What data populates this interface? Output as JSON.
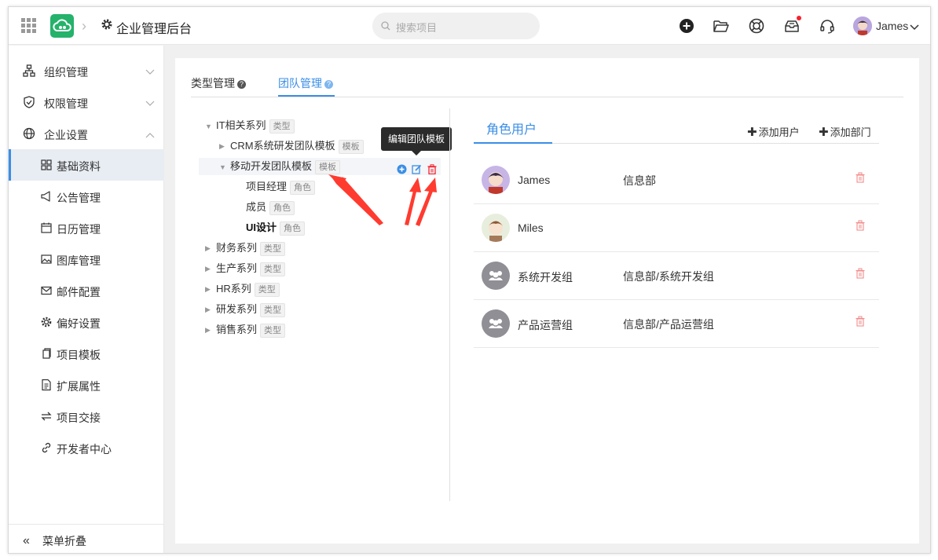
{
  "app": {
    "title": "企业管理后台",
    "search_placeholder": "搜索项目",
    "user_name": "James"
  },
  "sidebar": {
    "groups": [
      {
        "label": "组织管理"
      },
      {
        "label": "权限管理"
      },
      {
        "label": "企业设置"
      }
    ],
    "items": [
      {
        "label": "基础资料"
      },
      {
        "label": "公告管理"
      },
      {
        "label": "日历管理"
      },
      {
        "label": "图库管理"
      },
      {
        "label": "邮件配置"
      },
      {
        "label": "偏好设置"
      },
      {
        "label": "项目模板"
      },
      {
        "label": "扩展属性"
      },
      {
        "label": "项目交接"
      },
      {
        "label": "开发者中心"
      }
    ],
    "collapse_label": "菜单折叠"
  },
  "tabs": [
    {
      "label": "类型管理",
      "icon": "?"
    },
    {
      "label": "团队管理",
      "icon": "?"
    }
  ],
  "tree": {
    "tag_type": "类型",
    "tag_template": "模板",
    "tag_role": "角色",
    "nodes": [
      {
        "label": "IT相关系列"
      },
      {
        "label": "CRM系统研发团队模板"
      },
      {
        "label": "移动开发团队模板"
      },
      {
        "label": "项目经理"
      },
      {
        "label": "成员"
      },
      {
        "label": "UI设计"
      },
      {
        "label": "财务系列"
      },
      {
        "label": "生产系列"
      },
      {
        "label": "HR系列"
      },
      {
        "label": "研发系列"
      },
      {
        "label": "销售系列"
      }
    ],
    "tooltip": "编辑团队模板"
  },
  "right": {
    "tab": "角色用户",
    "add_user": "添加用户",
    "add_dept": "添加部门",
    "rows": [
      {
        "name": "James",
        "dept": "信息部"
      },
      {
        "name": "Miles",
        "dept": ""
      },
      {
        "name": "系统开发组",
        "dept": "信息部/系统开发组"
      },
      {
        "name": "产品运营组",
        "dept": "信息部/产品运营组"
      }
    ]
  },
  "colors": {
    "accent": "#3a8ee6",
    "danger": "#f5222d",
    "annotation": "#ff3b30"
  }
}
